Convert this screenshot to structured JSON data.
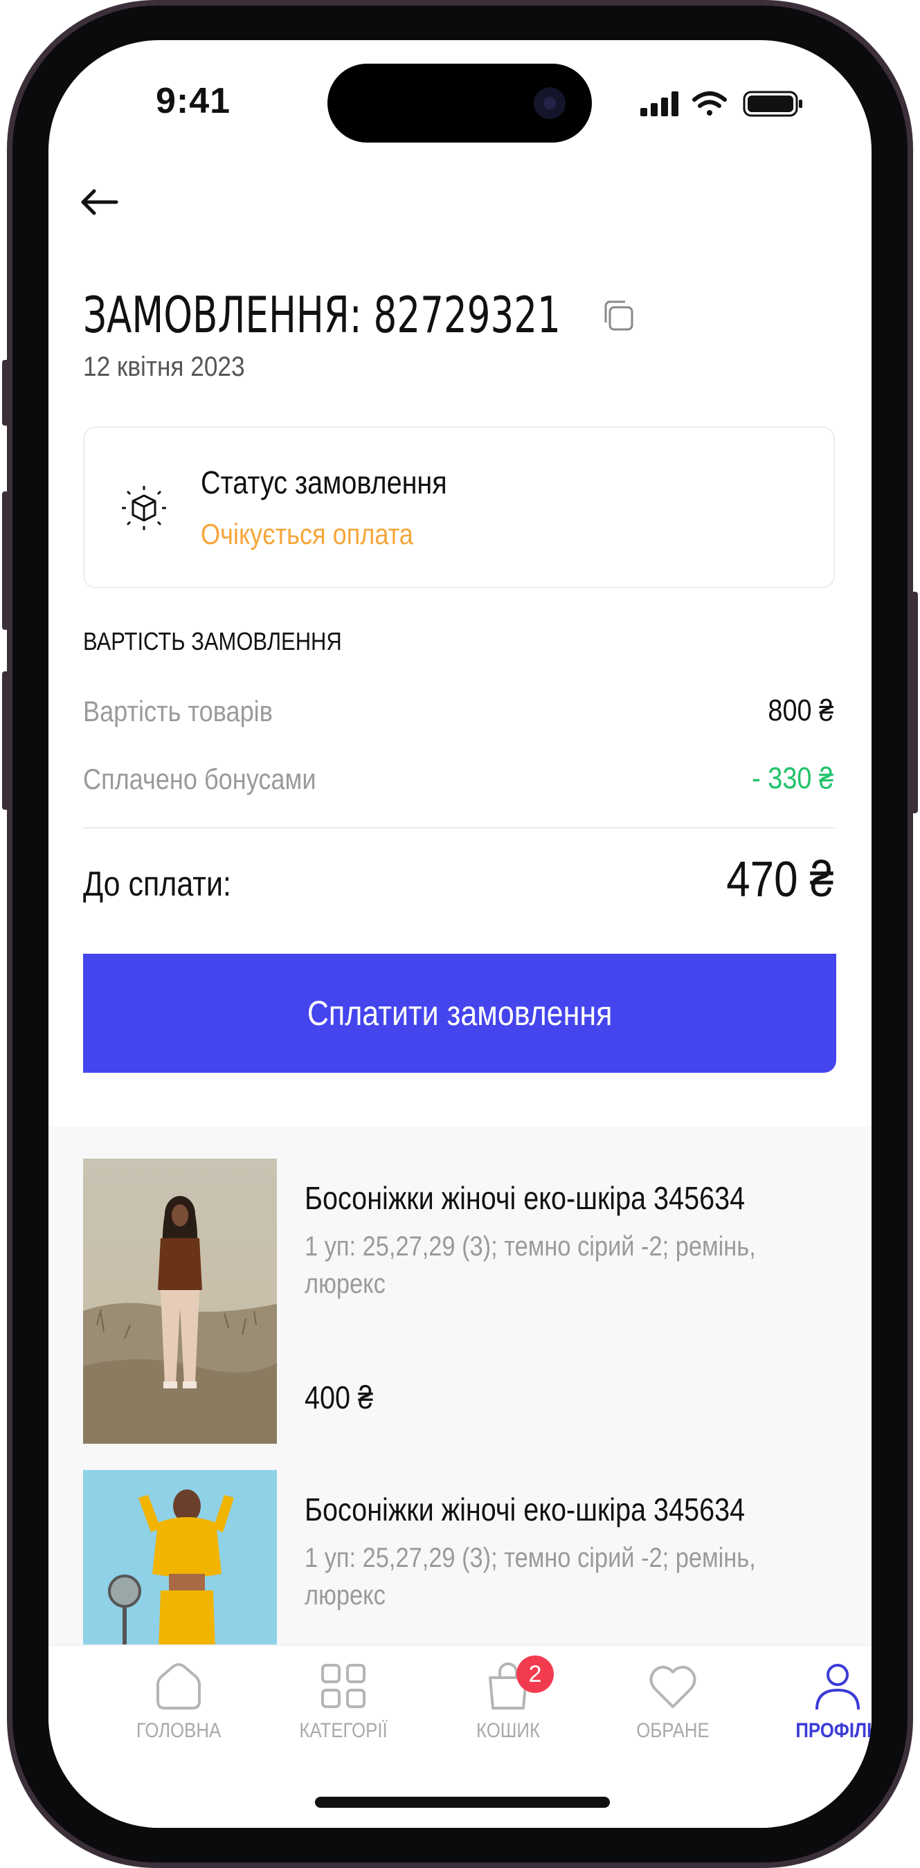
{
  "status_bar": {
    "time": "9:41"
  },
  "order": {
    "title": "ЗАМОВЛЕННЯ: 82729321",
    "date": "12 квітня 2023",
    "status_title": "Статус замовлення",
    "status_value": "Очікується оплата"
  },
  "cost": {
    "section_label": "ВАРТІСТЬ ЗАМОВЛЕННЯ",
    "goods_label": "Вартість товарів",
    "goods_value": "800 ₴",
    "bonus_label": "Сплачено бонусами",
    "bonus_value": "- 330 ₴",
    "total_label": "До сплати:",
    "total_value": "470 ₴"
  },
  "pay_button": "Сплатити замовлення",
  "products": [
    {
      "name": "Босоніжки жіночі еко-шкіра 345634",
      "description": "1 уп: 25,27,29 (3); темно сірий -2; ремінь, люрекс",
      "price": "400 ₴"
    },
    {
      "name": "Босоніжки жіночі еко-шкіра 345634",
      "description": "1 уп: 25,27,29 (3); темно сірий -2; ремінь, люрекс"
    }
  ],
  "tabbar": {
    "home": "ГОЛОВНА",
    "categories": "КАТЕГОРІЇ",
    "cart": "КОШИК",
    "cart_badge": "2",
    "favorites": "ОБРАНЕ",
    "profile": "ПРОФІЛЬ"
  },
  "colors": {
    "accent": "#4545ee",
    "status_pending": "#f6a53a",
    "bonus_green": "#21c26a",
    "badge_red": "#f33b4f"
  }
}
